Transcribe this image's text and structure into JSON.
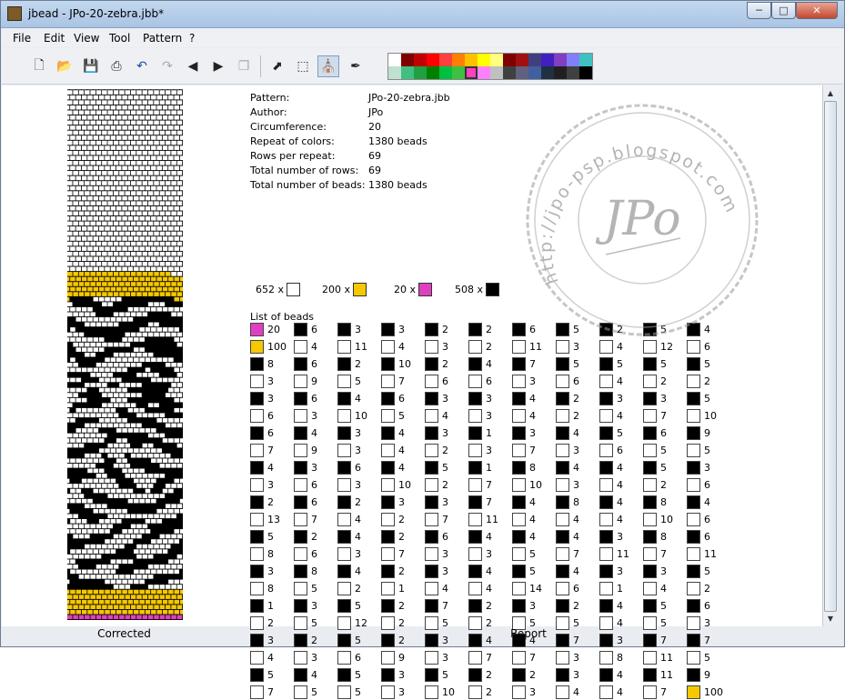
{
  "window": {
    "title": "jbead - JPo-20-zebra.jbb*"
  },
  "menu": [
    "File",
    "Edit",
    "View",
    "Tool",
    "Pattern",
    "?"
  ],
  "palette": {
    "row1": [
      "#ffffff",
      "#800000",
      "#c00000",
      "#ff0000",
      "#ff4040",
      "#ff8000",
      "#ffc000",
      "#ffff00",
      "#ffff80",
      "#800000",
      "#a01010",
      "#404080",
      "#4020c0",
      "#8040c0",
      "#8080ff",
      "#40c0c0"
    ],
    "row2": [
      "#c0e0d0",
      "#40c080",
      "#20a040",
      "#008000",
      "#00c040",
      "#40c040",
      "#ff40c0",
      "#ff80ff",
      "#c0c0c0",
      "#404040",
      "#606080",
      "#4060a0",
      "#203040",
      "#202020",
      "#404040",
      "#000000"
    ],
    "selected_index": 22
  },
  "colors": {
    "white": "#ffffff",
    "yellow": "#f5c800",
    "pink": "#e040c0",
    "black": "#000000"
  },
  "info": {
    "pattern_label": "Pattern:",
    "pattern_value": "JPo-20-zebra.jbb",
    "author_label": "Author:",
    "author_value": "JPo",
    "circumference_label": "Circumference:",
    "circumference_value": "20",
    "repeat_label": "Repeat of colors:",
    "repeat_value": "1380 beads",
    "rows_per_repeat_label": "Rows per repeat:",
    "rows_per_repeat_value": "69",
    "total_rows_label": "Total number of rows:",
    "total_rows_value": "69",
    "total_beads_label": "Total number of beads:",
    "total_beads_value": "1380 beads"
  },
  "summary": [
    {
      "count": "652 x",
      "color": "white"
    },
    {
      "count": "200 x",
      "color": "yellow"
    },
    {
      "count": "20 x",
      "color": "pink"
    },
    {
      "count": "508 x",
      "color": "black"
    }
  ],
  "list_title": "List of beads",
  "beads": [
    [
      [
        "pink",
        "20"
      ],
      [
        "yellow",
        "100"
      ],
      [
        "black",
        "8"
      ],
      [
        "white",
        "3"
      ],
      [
        "black",
        "3"
      ],
      [
        "white",
        "6"
      ],
      [
        "black",
        "6"
      ],
      [
        "white",
        "7"
      ],
      [
        "black",
        "4"
      ],
      [
        "white",
        "3"
      ],
      [
        "black",
        "2"
      ],
      [
        "white",
        "13"
      ],
      [
        "black",
        "5"
      ],
      [
        "white",
        "8"
      ],
      [
        "black",
        "3"
      ],
      [
        "white",
        "8"
      ],
      [
        "black",
        "1"
      ],
      [
        "white",
        "2"
      ],
      [
        "black",
        "3"
      ],
      [
        "white",
        "4"
      ],
      [
        "black",
        "5"
      ],
      [
        "white",
        "7"
      ]
    ],
    [
      [
        "black",
        "6"
      ],
      [
        "white",
        "4"
      ],
      [
        "black",
        "6"
      ],
      [
        "white",
        "9"
      ],
      [
        "black",
        "6"
      ],
      [
        "white",
        "3"
      ],
      [
        "black",
        "4"
      ],
      [
        "white",
        "9"
      ],
      [
        "black",
        "3"
      ],
      [
        "white",
        "6"
      ],
      [
        "black",
        "6"
      ],
      [
        "white",
        "7"
      ],
      [
        "black",
        "2"
      ],
      [
        "white",
        "6"
      ],
      [
        "black",
        "8"
      ],
      [
        "white",
        "5"
      ],
      [
        "black",
        "3"
      ],
      [
        "white",
        "5"
      ],
      [
        "black",
        "2"
      ],
      [
        "white",
        "3"
      ],
      [
        "black",
        "4"
      ],
      [
        "white",
        "5"
      ]
    ],
    [
      [
        "black",
        "3"
      ],
      [
        "white",
        "11"
      ],
      [
        "black",
        "2"
      ],
      [
        "white",
        "5"
      ],
      [
        "black",
        "4"
      ],
      [
        "white",
        "10"
      ],
      [
        "black",
        "3"
      ],
      [
        "white",
        "3"
      ],
      [
        "black",
        "6"
      ],
      [
        "white",
        "3"
      ],
      [
        "black",
        "2"
      ],
      [
        "white",
        "4"
      ],
      [
        "black",
        "4"
      ],
      [
        "white",
        "3"
      ],
      [
        "black",
        "4"
      ],
      [
        "white",
        "2"
      ],
      [
        "black",
        "5"
      ],
      [
        "white",
        "12"
      ],
      [
        "black",
        "5"
      ],
      [
        "white",
        "6"
      ],
      [
        "black",
        "5"
      ],
      [
        "white",
        "5"
      ]
    ],
    [
      [
        "black",
        "3"
      ],
      [
        "white",
        "4"
      ],
      [
        "black",
        "10"
      ],
      [
        "white",
        "7"
      ],
      [
        "black",
        "6"
      ],
      [
        "white",
        "5"
      ],
      [
        "black",
        "4"
      ],
      [
        "white",
        "4"
      ],
      [
        "black",
        "4"
      ],
      [
        "white",
        "10"
      ],
      [
        "black",
        "3"
      ],
      [
        "white",
        "2"
      ],
      [
        "black",
        "2"
      ],
      [
        "white",
        "7"
      ],
      [
        "black",
        "2"
      ],
      [
        "white",
        "1"
      ],
      [
        "black",
        "2"
      ],
      [
        "white",
        "2"
      ],
      [
        "black",
        "2"
      ],
      [
        "white",
        "9"
      ],
      [
        "black",
        "3"
      ],
      [
        "white",
        "3"
      ]
    ],
    [
      [
        "black",
        "2"
      ],
      [
        "white",
        "3"
      ],
      [
        "black",
        "2"
      ],
      [
        "white",
        "6"
      ],
      [
        "black",
        "3"
      ],
      [
        "white",
        "4"
      ],
      [
        "black",
        "3"
      ],
      [
        "white",
        "2"
      ],
      [
        "black",
        "5"
      ],
      [
        "white",
        "2"
      ],
      [
        "black",
        "3"
      ],
      [
        "white",
        "7"
      ],
      [
        "black",
        "6"
      ],
      [
        "white",
        "3"
      ],
      [
        "black",
        "3"
      ],
      [
        "white",
        "4"
      ],
      [
        "black",
        "7"
      ],
      [
        "white",
        "5"
      ],
      [
        "black",
        "3"
      ],
      [
        "white",
        "3"
      ],
      [
        "black",
        "5"
      ],
      [
        "white",
        "10"
      ]
    ],
    [
      [
        "black",
        "2"
      ],
      [
        "white",
        "2"
      ],
      [
        "black",
        "4"
      ],
      [
        "white",
        "6"
      ],
      [
        "black",
        "3"
      ],
      [
        "white",
        "3"
      ],
      [
        "black",
        "1"
      ],
      [
        "white",
        "3"
      ],
      [
        "black",
        "1"
      ],
      [
        "white",
        "7"
      ],
      [
        "black",
        "7"
      ],
      [
        "white",
        "11"
      ],
      [
        "black",
        "4"
      ],
      [
        "white",
        "3"
      ],
      [
        "black",
        "4"
      ],
      [
        "white",
        "4"
      ],
      [
        "black",
        "2"
      ],
      [
        "white",
        "2"
      ],
      [
        "black",
        "4"
      ],
      [
        "white",
        "7"
      ],
      [
        "black",
        "2"
      ],
      [
        "white",
        "2"
      ]
    ],
    [
      [
        "black",
        "6"
      ],
      [
        "white",
        "11"
      ],
      [
        "black",
        "7"
      ],
      [
        "white",
        "3"
      ],
      [
        "black",
        "4"
      ],
      [
        "white",
        "4"
      ],
      [
        "black",
        "3"
      ],
      [
        "white",
        "7"
      ],
      [
        "black",
        "8"
      ],
      [
        "white",
        "10"
      ],
      [
        "black",
        "4"
      ],
      [
        "white",
        "4"
      ],
      [
        "black",
        "4"
      ],
      [
        "white",
        "5"
      ],
      [
        "black",
        "5"
      ],
      [
        "white",
        "14"
      ],
      [
        "black",
        "3"
      ],
      [
        "white",
        "5"
      ],
      [
        "black",
        "4"
      ],
      [
        "white",
        "7"
      ],
      [
        "black",
        "2"
      ],
      [
        "white",
        "3"
      ]
    ],
    [
      [
        "black",
        "5"
      ],
      [
        "white",
        "3"
      ],
      [
        "black",
        "5"
      ],
      [
        "white",
        "6"
      ],
      [
        "black",
        "2"
      ],
      [
        "white",
        "2"
      ],
      [
        "black",
        "4"
      ],
      [
        "white",
        "3"
      ],
      [
        "black",
        "4"
      ],
      [
        "white",
        "3"
      ],
      [
        "black",
        "8"
      ],
      [
        "white",
        "4"
      ],
      [
        "black",
        "4"
      ],
      [
        "white",
        "7"
      ],
      [
        "black",
        "4"
      ],
      [
        "white",
        "6"
      ],
      [
        "black",
        "2"
      ],
      [
        "white",
        "5"
      ],
      [
        "black",
        "7"
      ],
      [
        "white",
        "3"
      ],
      [
        "black",
        "3"
      ],
      [
        "white",
        "4"
      ]
    ],
    [
      [
        "black",
        "2"
      ],
      [
        "white",
        "4"
      ],
      [
        "black",
        "5"
      ],
      [
        "white",
        "4"
      ],
      [
        "black",
        "3"
      ],
      [
        "white",
        "4"
      ],
      [
        "black",
        "5"
      ],
      [
        "white",
        "6"
      ],
      [
        "black",
        "4"
      ],
      [
        "white",
        "4"
      ],
      [
        "black",
        "4"
      ],
      [
        "white",
        "4"
      ],
      [
        "black",
        "3"
      ],
      [
        "white",
        "11"
      ],
      [
        "black",
        "3"
      ],
      [
        "white",
        "1"
      ],
      [
        "black",
        "4"
      ],
      [
        "white",
        "4"
      ],
      [
        "black",
        "3"
      ],
      [
        "white",
        "8"
      ],
      [
        "black",
        "4"
      ],
      [
        "white",
        "4"
      ]
    ],
    [
      [
        "black",
        "5"
      ],
      [
        "white",
        "12"
      ],
      [
        "black",
        "5"
      ],
      [
        "white",
        "2"
      ],
      [
        "black",
        "3"
      ],
      [
        "white",
        "7"
      ],
      [
        "black",
        "6"
      ],
      [
        "white",
        "5"
      ],
      [
        "black",
        "5"
      ],
      [
        "white",
        "2"
      ],
      [
        "black",
        "8"
      ],
      [
        "white",
        "10"
      ],
      [
        "black",
        "8"
      ],
      [
        "white",
        "7"
      ],
      [
        "black",
        "3"
      ],
      [
        "white",
        "4"
      ],
      [
        "black",
        "5"
      ],
      [
        "white",
        "5"
      ],
      [
        "black",
        "7"
      ],
      [
        "white",
        "11"
      ],
      [
        "black",
        "11"
      ],
      [
        "white",
        "7"
      ]
    ],
    [
      [
        "black",
        "4"
      ],
      [
        "white",
        "6"
      ],
      [
        "black",
        "5"
      ],
      [
        "white",
        "2"
      ],
      [
        "black",
        "5"
      ],
      [
        "white",
        "10"
      ],
      [
        "black",
        "9"
      ],
      [
        "white",
        "5"
      ],
      [
        "black",
        "3"
      ],
      [
        "white",
        "6"
      ],
      [
        "black",
        "4"
      ],
      [
        "white",
        "6"
      ],
      [
        "black",
        "6"
      ],
      [
        "white",
        "11"
      ],
      [
        "black",
        "5"
      ],
      [
        "white",
        "2"
      ],
      [
        "black",
        "6"
      ],
      [
        "white",
        "3"
      ],
      [
        "black",
        "7"
      ],
      [
        "white",
        "5"
      ],
      [
        "black",
        "9"
      ],
      [
        "yellow",
        "100"
      ]
    ]
  ],
  "labels": {
    "corrected": "Corrected",
    "report": "Report"
  },
  "stamp": {
    "initials": "JPo",
    "url": "http://jpo-psp.blogspot.com"
  }
}
